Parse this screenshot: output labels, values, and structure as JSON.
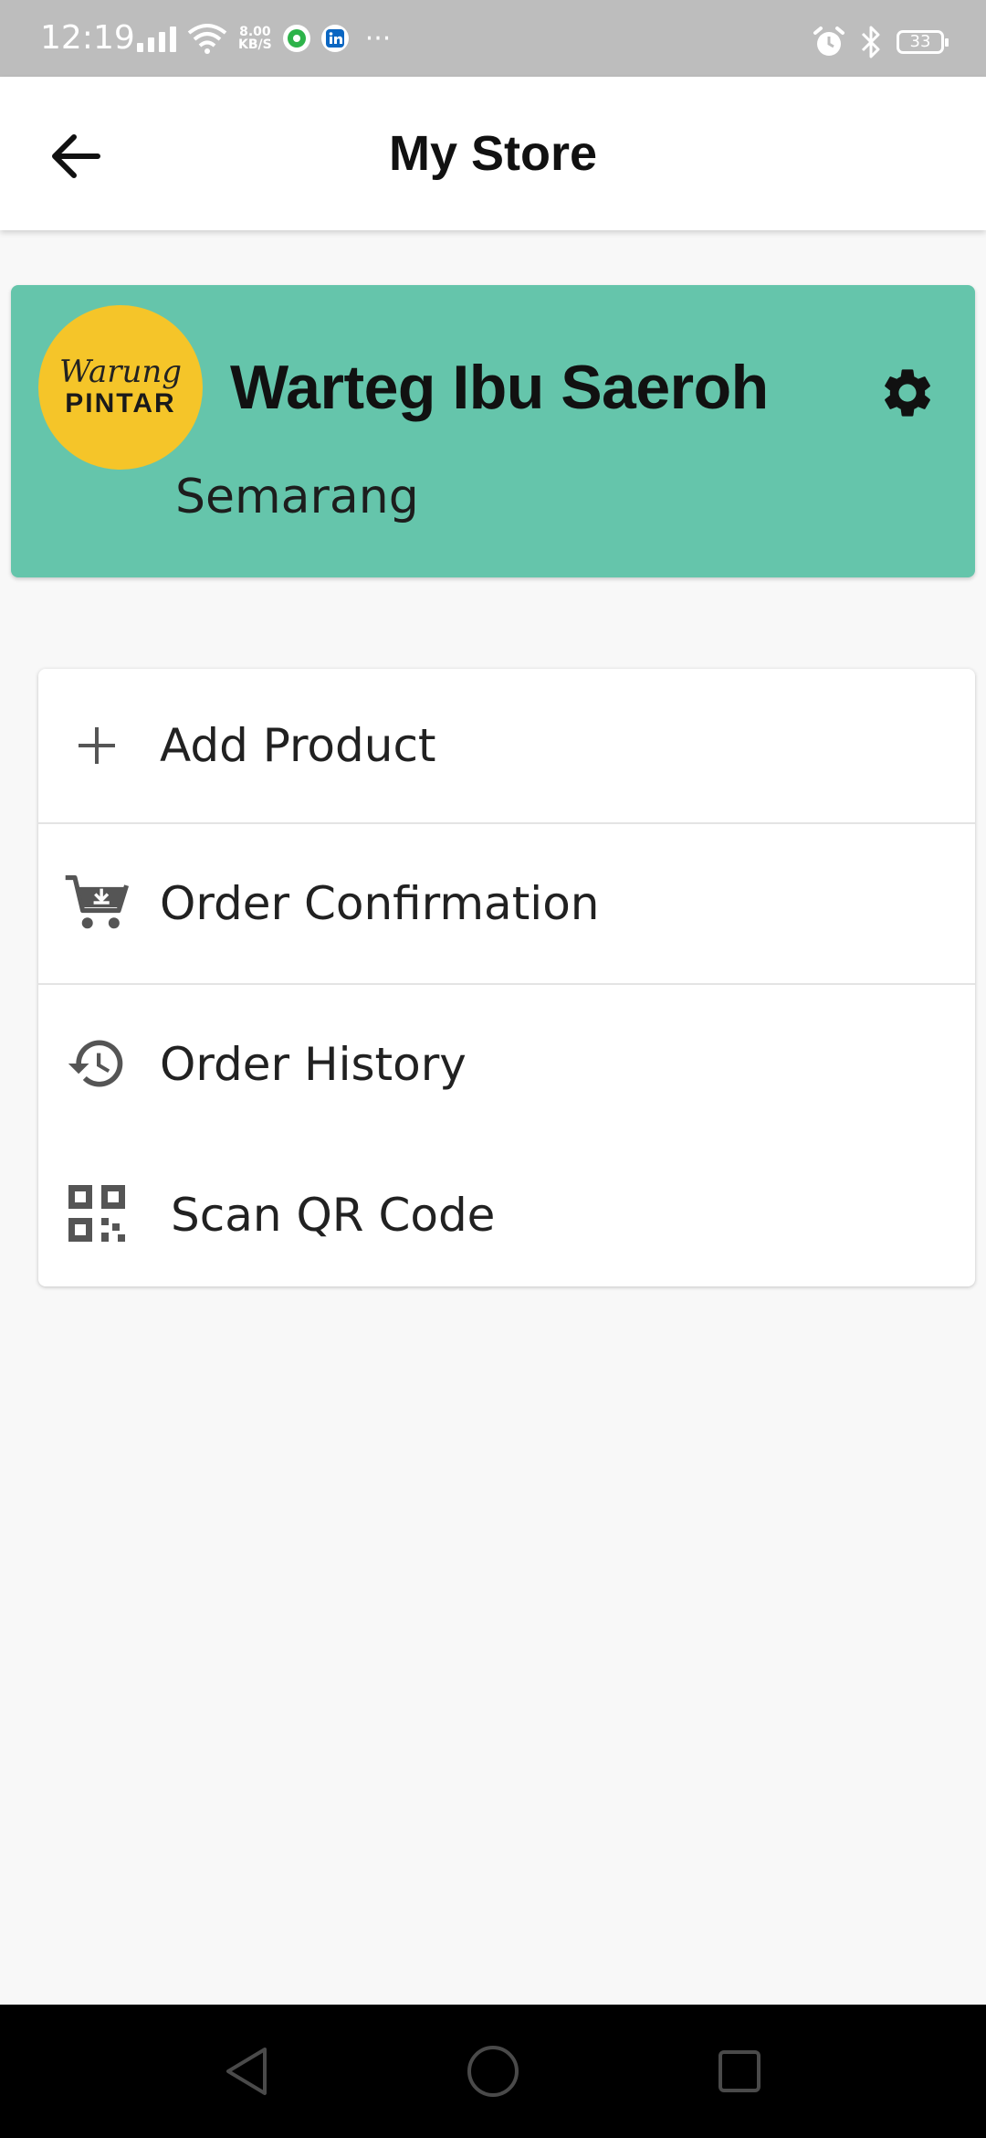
{
  "status_bar": {
    "time": "12:19",
    "speed_value": "8.00",
    "speed_unit": "KB/S",
    "battery": "33",
    "more": "···"
  },
  "header": {
    "title": "My Store"
  },
  "store": {
    "name": "Warteg Ibu Saeroh",
    "city": "Semarang",
    "logo_script": "Warung",
    "logo_word": "PINTAR",
    "card_color": "#65c5ab",
    "logo_color": "#f5c529"
  },
  "menu": {
    "items": [
      {
        "label": "Add Product",
        "icon": "plus-icon"
      },
      {
        "label": "Order Confirmation",
        "icon": "cart-download-icon"
      },
      {
        "label": "Order History",
        "icon": "history-icon"
      },
      {
        "label": "Scan QR Code",
        "icon": "qr-code-icon"
      }
    ]
  },
  "navigation": {
    "back": "back-triangle-icon",
    "home": "home-circle-icon",
    "recents": "recents-square-icon"
  }
}
